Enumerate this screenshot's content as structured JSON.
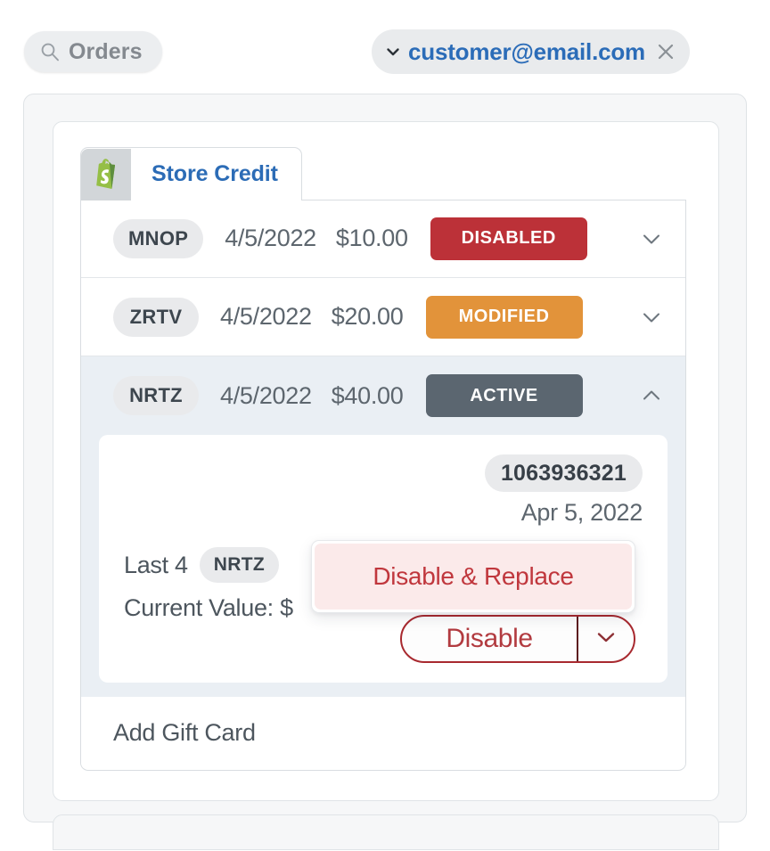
{
  "topbar": {
    "orders_button": {
      "label": "Orders",
      "icon": "search-icon"
    },
    "customer_chip": {
      "email": "customer@email.com",
      "expand_icon": "chevron-down-icon",
      "close_icon": "close-icon",
      "accent_color": "#2b6cb8"
    }
  },
  "tab": {
    "label": "Store Credit",
    "icon": "shopify-icon",
    "active_color": "#2c6cb6"
  },
  "gift_cards": [
    {
      "code": "MNOP",
      "date": "4/5/2022",
      "amount": "$10.00",
      "status": "DISABLED",
      "status_color": "#bc3138",
      "chevron": "chevron-down-icon",
      "expanded": false
    },
    {
      "code": "ZRTV",
      "date": "4/5/2022",
      "amount": "$20.00",
      "status": "MODIFIED",
      "status_color": "#e2933a",
      "chevron": "chevron-down-icon",
      "expanded": false
    },
    {
      "code": "NRTZ",
      "date": "4/5/2022",
      "amount": "$40.00",
      "status": "ACTIVE",
      "status_color": "#5b6670",
      "chevron": "chevron-up-icon",
      "expanded": true
    }
  ],
  "expanded_detail": {
    "gift_card_number": "1063936321",
    "created_date": "Apr 5, 2022",
    "last4_label": "Last 4",
    "last4_value": "NRTZ",
    "current_value_label": "Current Value: $",
    "actions": {
      "disable_button": "Disable",
      "caret_icon": "chevron-down-icon",
      "menu_items": [
        {
          "label": "Disable & Replace",
          "color": "#c0373d",
          "background": "#fbeaea"
        }
      ]
    }
  },
  "footer": {
    "add_gift_card": "Add Gift Card"
  }
}
